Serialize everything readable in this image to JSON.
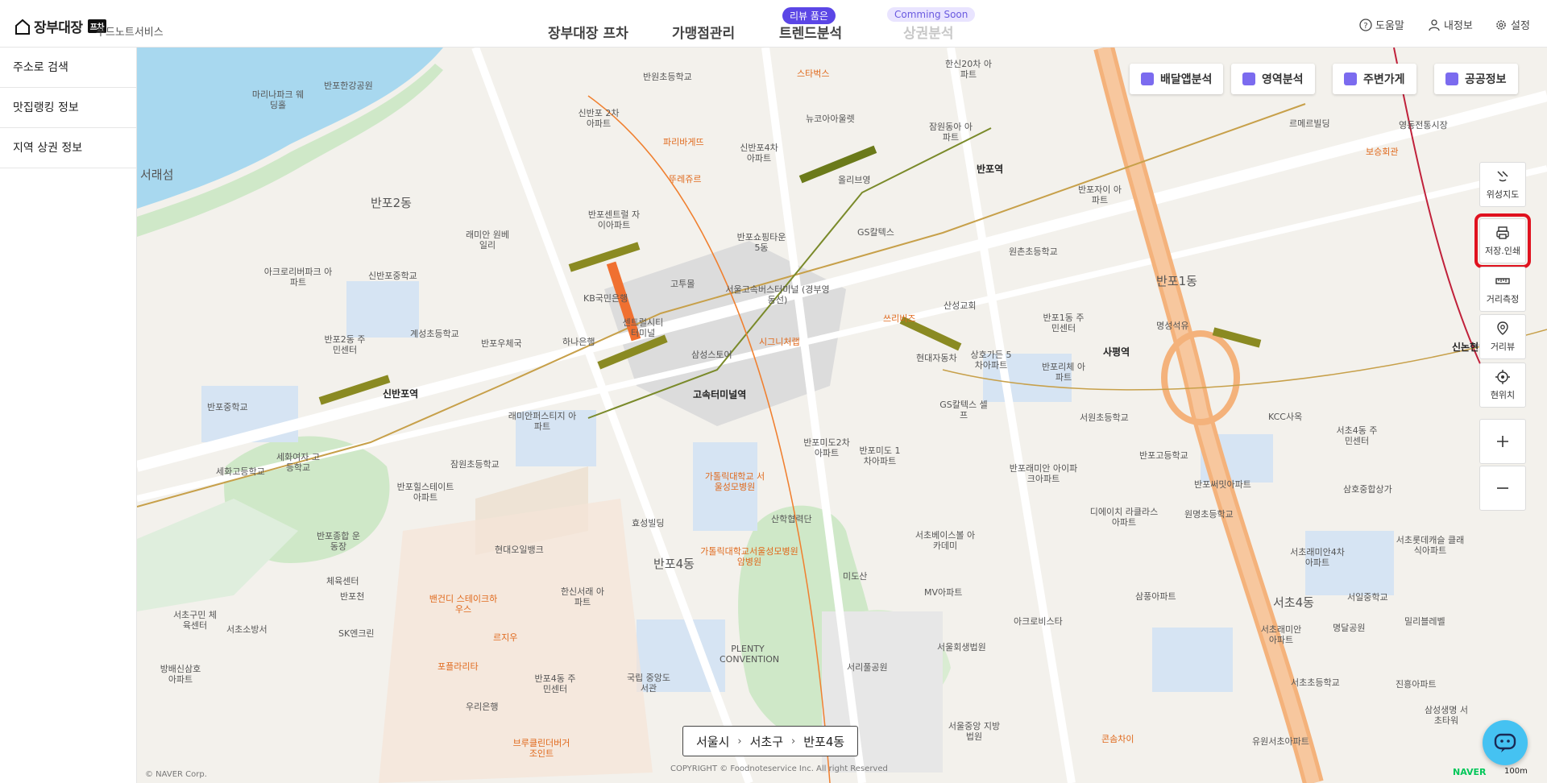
{
  "header": {
    "logo_text": "장부대장",
    "logo_badge": "프차",
    "brand": "푸드노트서비스",
    "nav": [
      {
        "label": "장부대장 프차"
      },
      {
        "label": "가맹점관리"
      },
      {
        "label": "트렌드분석",
        "badge": "리뷰 품은"
      },
      {
        "label": "상권분석",
        "badge": "Comming Soon"
      }
    ],
    "utils": {
      "help": "도움말",
      "myinfo": "내정보",
      "settings": "설정"
    }
  },
  "sidebar": {
    "items": [
      {
        "label": "주소로 검색"
      },
      {
        "label": "맛집랭킹 정보"
      },
      {
        "label": "지역 상권 정보"
      }
    ]
  },
  "map_buttons": [
    {
      "label": "배달앱분석"
    },
    {
      "label": "영역분석"
    },
    {
      "label": "주변가게"
    },
    {
      "label": "공공정보"
    }
  ],
  "right_tools": [
    {
      "label": "위성지도"
    },
    {
      "label": "저장.인쇄"
    },
    {
      "label": "거리측정"
    },
    {
      "label": "거리뷰"
    },
    {
      "label": "현위치"
    }
  ],
  "breadcrumb": [
    "서울시",
    "서초구",
    "반포4동"
  ],
  "map": {
    "areas": [
      "반포2동",
      "반포4동",
      "반포1동",
      "서초4동",
      "서래섬"
    ],
    "stations": [
      "신반포역",
      "고속터미널역",
      "반포역",
      "사평역",
      "신논현역"
    ],
    "pois": [
      "반포한강공원",
      "마리나파크 웨딩홀",
      "반원초등학교",
      "스타벅스",
      "신반포 2차아파트",
      "신반포4차 아파트",
      "뉴코아아울렛",
      "파리바게뜨",
      "뚜레쥬르",
      "올리브영",
      "한신20차 아파트",
      "잠원동아 아파트",
      "반포센트럴 자이아파트",
      "래미안 원베일리",
      "아크로리버파크 아파트",
      "신반포중학교",
      "반포2동 주민센터",
      "계성초등학교",
      "반포우체국",
      "하나은행",
      "KB국민은행",
      "반포쇼핑타운 5동",
      "고투몰",
      "서울고속버스터미널 (경부영동선)",
      "센트럴시티 터미널",
      "삼성스토어",
      "시그니처랩",
      "쓰리비즈",
      "현대자동차",
      "산성교회",
      "반포자이 아파트",
      "원촌초등학교",
      "GS칼텍스",
      "반포1동 주민센터",
      "상호가든 5차아파트",
      "반포리체 아파트",
      "명성석유",
      "르메르빌딩",
      "보승회관",
      "영동전통시장",
      "반포중학교",
      "세화여자 고등학교",
      "세화고등학교",
      "잠원초등학교",
      "래미안퍼스티지 아파트",
      "반포힐스테이트 아파트",
      "가톨릭대학교 서울성모병원",
      "반포미도2차 아파트",
      "반포미도 1차아파트",
      "GS칼텍스 셀프",
      "서원초등학교",
      "반포고등학교",
      "반포래미안 아이파크아파트",
      "반포써밋아파트",
      "KCC사옥",
      "서초4동 주민센터",
      "삼호중합상가",
      "효성빌딩",
      "산학협력단",
      "가톨릭대학교서울성모병원 암병원",
      "반포종합 운동장",
      "체육센터",
      "현대오일뱅크",
      "서초베이스볼 아카데미",
      "디에이치 라클라스아파트",
      "원명초등학교",
      "서초래미안4차 아파트",
      "서초롯데캐슬 클래식아파트",
      "반포천",
      "서초구민 체육센터",
      "서초소방서",
      "SK엔크린",
      "밴건디 스테이크하우스",
      "한신서래 아파트",
      "미도산",
      "MV아파트",
      "아크로비스타",
      "삼풍아파트",
      "서울중앙 지방법원",
      "서초래미안 아파트",
      "명달공원",
      "서일중학교",
      "서초초등학교",
      "밀리블레벨",
      "진흥아파트",
      "방배신삼호 아파트",
      "르지우",
      "포플라리타",
      "반포4동 주민센터",
      "국립 중앙도서관",
      "우리은행",
      "PLENTY CONVENTION",
      "서리풀공원",
      "서울회생법원",
      "브루클린더버거 조인트",
      "콘솜차이",
      "유원서초아파트",
      "삼성생명 서초타워"
    ],
    "copyright_left": "© NAVER Corp.",
    "copyright_center": "COPYRIGHT © Foodnoteservice Inc. All right Reserved",
    "scale": "100m",
    "logo": "NAVER"
  },
  "colors": {
    "accent": "#5b46e6",
    "highlight": "#e0121f",
    "chat": "#45c2f2"
  }
}
